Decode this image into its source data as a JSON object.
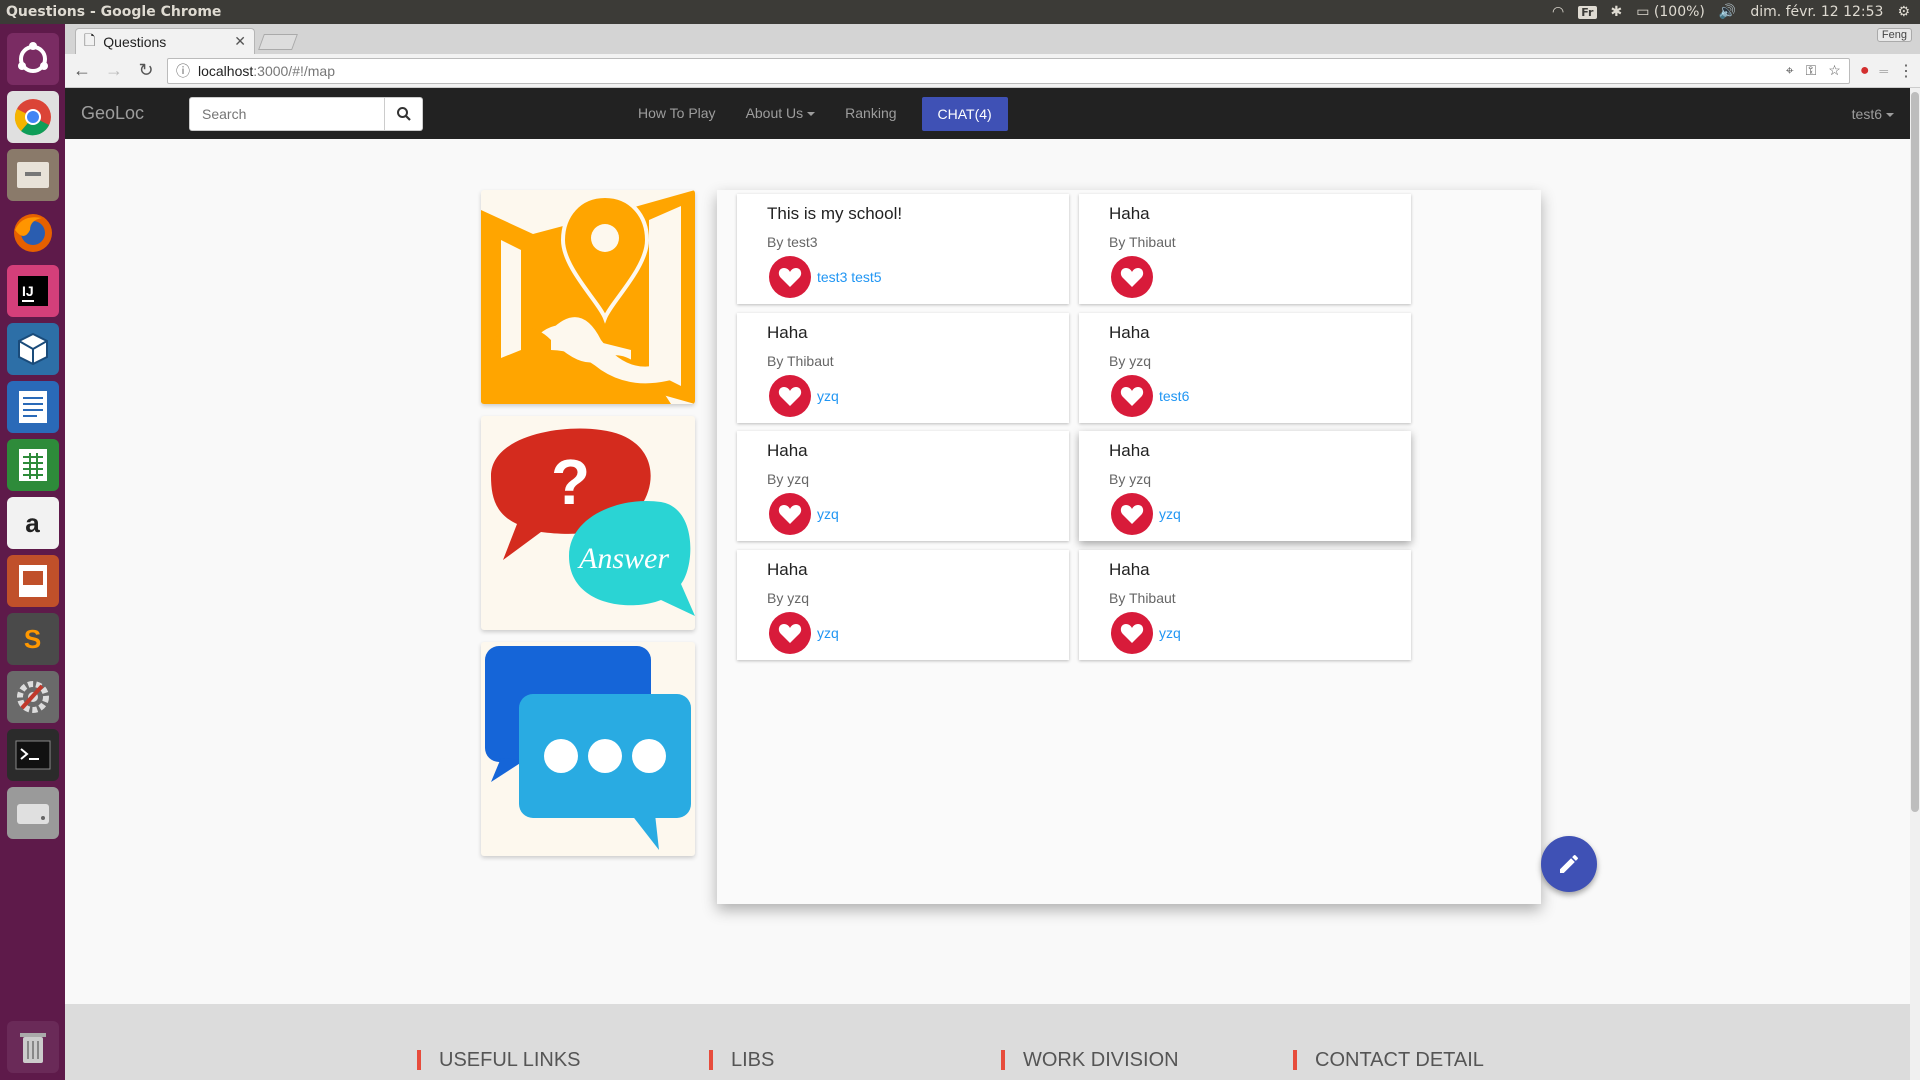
{
  "os_panel": {
    "window_title": "Questions - Google Chrome",
    "keyboard": "Fr",
    "battery": "(100%)",
    "datetime": "dim. févr. 12 12:53"
  },
  "launcher": {
    "items": [
      "ubuntu-dash",
      "chrome",
      "files",
      "firefox",
      "intellij",
      "virtualbox",
      "writer",
      "calc",
      "amazon",
      "impress",
      "sublime",
      "settings",
      "terminal",
      "disk",
      "trash"
    ]
  },
  "browser": {
    "tab_title": "Questions",
    "profile": "Feng",
    "url_host": "localhost",
    "url_path": ":3000/#!/map"
  },
  "navbar": {
    "brand": "GeoLoc",
    "search_placeholder": "Search",
    "links": {
      "how_to_play": "How To Play",
      "about_us": "About Us",
      "ranking": "Ranking",
      "chat": "CHAT(4)"
    },
    "user": "test6"
  },
  "tiles": [
    {
      "name": "map",
      "word": ""
    },
    {
      "name": "question-answer",
      "word": "Answer"
    },
    {
      "name": "chat",
      "word": ""
    }
  ],
  "questions": [
    {
      "title": "This is my school!",
      "author": "By test3",
      "likers": "test3 test5"
    },
    {
      "title": "Haha",
      "author": "By Thibaut",
      "likers": ""
    },
    {
      "title": "Haha",
      "author": "By Thibaut",
      "likers": "yzq"
    },
    {
      "title": "Haha",
      "author": "By yzq",
      "likers": "test6"
    },
    {
      "title": "Haha",
      "author": "By yzq",
      "likers": "yzq"
    },
    {
      "title": "Haha",
      "author": "By yzq",
      "likers": "yzq"
    },
    {
      "title": "Haha",
      "author": "By yzq",
      "likers": "yzq"
    },
    {
      "title": "Haha",
      "author": "By Thibaut",
      "likers": "yzq"
    }
  ],
  "footer": {
    "columns": [
      "USEFUL LINKS",
      "LIBS",
      "WORK DIVISION",
      "CONTACT DETAIL"
    ]
  },
  "colors": {
    "navbar_bg": "#222222",
    "chat_button": "#3f51b5",
    "heart": "#d81b3a",
    "link": "#2196f3",
    "fab": "#3f51b5",
    "footer_accent": "#e74c3c"
  }
}
